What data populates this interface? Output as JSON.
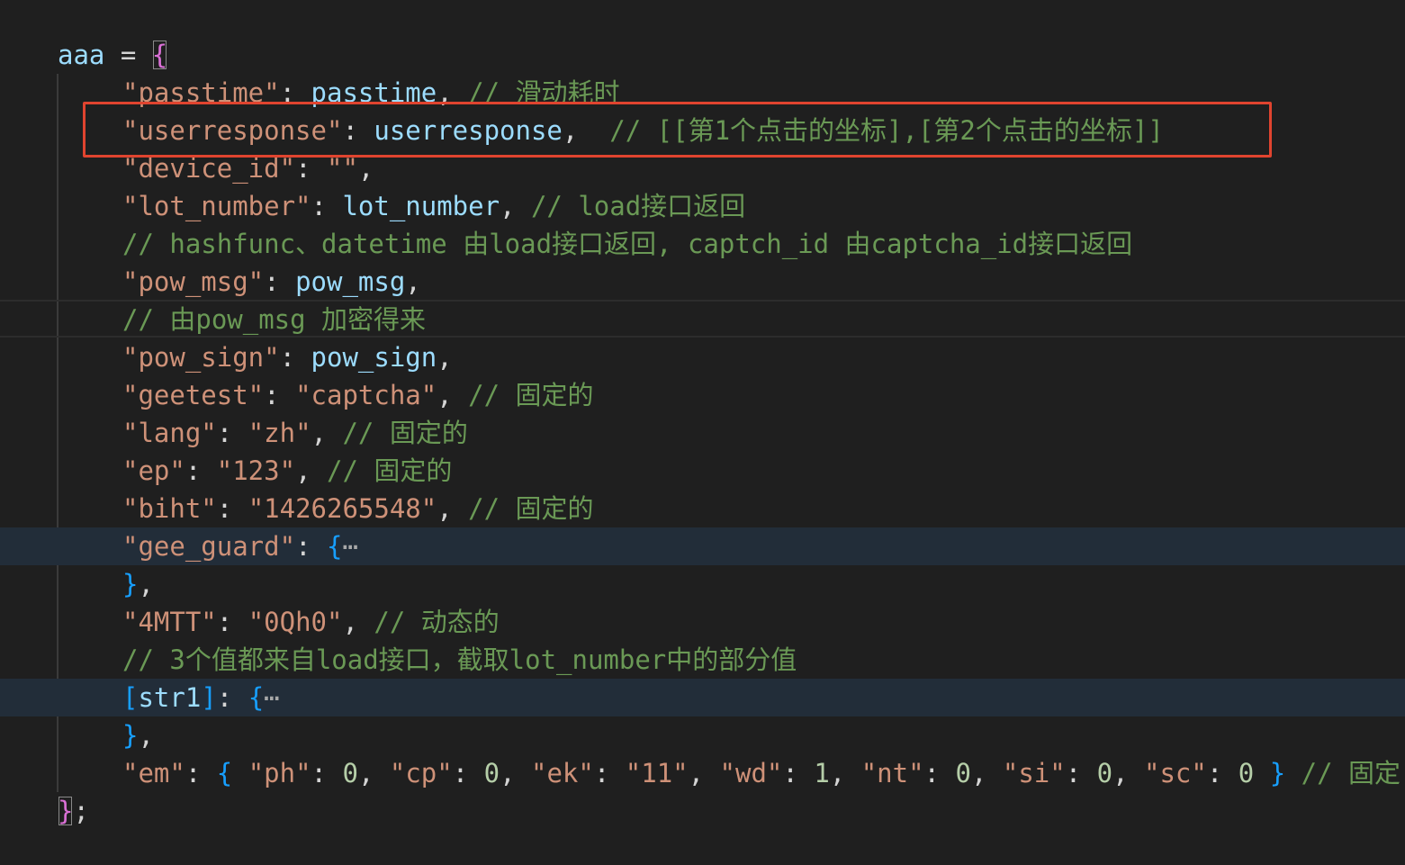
{
  "editor": {
    "lines": [
      {
        "t": [
          {
            "c": "var",
            "v": "aaa"
          },
          {
            "c": "pun",
            "v": " = "
          },
          {
            "c": "br1",
            "v": "{"
          }
        ]
      },
      {
        "t": [
          {
            "c": "str",
            "v": "\"passtime\""
          },
          {
            "c": "pun",
            "v": ": "
          },
          {
            "c": "var",
            "v": "passtime"
          },
          {
            "c": "pun",
            "v": ", "
          },
          {
            "c": "cmt",
            "v": "// 滑动耗时"
          }
        ]
      },
      {
        "t": [
          {
            "c": "str",
            "v": "\"userresponse\""
          },
          {
            "c": "pun",
            "v": ": "
          },
          {
            "c": "var",
            "v": "userresponse"
          },
          {
            "c": "pun",
            "v": ",  "
          },
          {
            "c": "cmt",
            "v": "// [[第1个点击的坐标],[第2个点击的坐标]]"
          }
        ]
      },
      {
        "t": [
          {
            "c": "str",
            "v": "\"device_id\""
          },
          {
            "c": "pun",
            "v": ": "
          },
          {
            "c": "str",
            "v": "\"\""
          },
          {
            "c": "pun",
            "v": ","
          }
        ]
      },
      {
        "t": [
          {
            "c": "str",
            "v": "\"lot_number\""
          },
          {
            "c": "pun",
            "v": ": "
          },
          {
            "c": "var",
            "v": "lot_number"
          },
          {
            "c": "pun",
            "v": ", "
          },
          {
            "c": "cmt",
            "v": "// load接口返回"
          }
        ]
      },
      {
        "t": [
          {
            "c": "cmt",
            "v": "// hashfunc、datetime 由load接口返回, captch_id 由captcha_id接口返回"
          }
        ]
      },
      {
        "t": [
          {
            "c": "str",
            "v": "\"pow_msg\""
          },
          {
            "c": "pun",
            "v": ": "
          },
          {
            "c": "var",
            "v": "pow_msg"
          },
          {
            "c": "pun",
            "v": ","
          }
        ]
      },
      {
        "t": [
          {
            "c": "cmt",
            "v": "// 由pow_msg 加密得来"
          }
        ]
      },
      {
        "t": [
          {
            "c": "str",
            "v": "\"pow_sign\""
          },
          {
            "c": "pun",
            "v": ": "
          },
          {
            "c": "var",
            "v": "pow_sign"
          },
          {
            "c": "pun",
            "v": ","
          }
        ]
      },
      {
        "t": [
          {
            "c": "str",
            "v": "\"geetest\""
          },
          {
            "c": "pun",
            "v": ": "
          },
          {
            "c": "str",
            "v": "\"captcha\""
          },
          {
            "c": "pun",
            "v": ", "
          },
          {
            "c": "cmt",
            "v": "// 固定的"
          }
        ]
      },
      {
        "t": [
          {
            "c": "str",
            "v": "\"lang\""
          },
          {
            "c": "pun",
            "v": ": "
          },
          {
            "c": "str",
            "v": "\"zh\""
          },
          {
            "c": "pun",
            "v": ", "
          },
          {
            "c": "cmt",
            "v": "// 固定的"
          }
        ]
      },
      {
        "t": [
          {
            "c": "str",
            "v": "\"ep\""
          },
          {
            "c": "pun",
            "v": ": "
          },
          {
            "c": "str",
            "v": "\"123\""
          },
          {
            "c": "pun",
            "v": ", "
          },
          {
            "c": "cmt",
            "v": "// 固定的"
          }
        ]
      },
      {
        "t": [
          {
            "c": "str",
            "v": "\"biht\""
          },
          {
            "c": "pun",
            "v": ": "
          },
          {
            "c": "str",
            "v": "\"1426265548\""
          },
          {
            "c": "pun",
            "v": ", "
          },
          {
            "c": "cmt",
            "v": "// 固定的"
          }
        ]
      },
      {
        "t": [
          {
            "c": "str",
            "v": "\"gee_guard\""
          },
          {
            "c": "pun",
            "v": ": "
          },
          {
            "c": "br2",
            "v": "{"
          },
          {
            "c": "ell",
            "v": "⋯"
          }
        ]
      },
      {
        "t": [
          {
            "c": "br2",
            "v": "}"
          },
          {
            "c": "pun",
            "v": ","
          }
        ]
      },
      {
        "t": [
          {
            "c": "str",
            "v": "\"4MTT\""
          },
          {
            "c": "pun",
            "v": ": "
          },
          {
            "c": "str",
            "v": "\"0Qh0\""
          },
          {
            "c": "pun",
            "v": ", "
          },
          {
            "c": "cmt",
            "v": "// 动态的"
          }
        ]
      },
      {
        "t": [
          {
            "c": "cmt",
            "v": "// 3个值都来自load接口，截取lot_number中的部分值"
          }
        ]
      },
      {
        "t": [
          {
            "c": "br2",
            "v": "["
          },
          {
            "c": "var",
            "v": "str1"
          },
          {
            "c": "br2",
            "v": "]"
          },
          {
            "c": "pun",
            "v": ": "
          },
          {
            "c": "br2",
            "v": "{"
          },
          {
            "c": "ell",
            "v": "⋯"
          }
        ]
      },
      {
        "t": [
          {
            "c": "br2",
            "v": "}"
          },
          {
            "c": "pun",
            "v": ","
          }
        ]
      },
      {
        "t": [
          {
            "c": "str",
            "v": "\"em\""
          },
          {
            "c": "pun",
            "v": ": "
          },
          {
            "c": "br2",
            "v": "{"
          },
          {
            "c": "pun",
            "v": " "
          },
          {
            "c": "str",
            "v": "\"ph\""
          },
          {
            "c": "pun",
            "v": ": "
          },
          {
            "c": "num",
            "v": "0"
          },
          {
            "c": "pun",
            "v": ", "
          },
          {
            "c": "str",
            "v": "\"cp\""
          },
          {
            "c": "pun",
            "v": ": "
          },
          {
            "c": "num",
            "v": "0"
          },
          {
            "c": "pun",
            "v": ", "
          },
          {
            "c": "str",
            "v": "\"ek\""
          },
          {
            "c": "pun",
            "v": ": "
          },
          {
            "c": "str",
            "v": "\"11\""
          },
          {
            "c": "pun",
            "v": ", "
          },
          {
            "c": "str",
            "v": "\"wd\""
          },
          {
            "c": "pun",
            "v": ": "
          },
          {
            "c": "num",
            "v": "1"
          },
          {
            "c": "pun",
            "v": ", "
          },
          {
            "c": "str",
            "v": "\"nt\""
          },
          {
            "c": "pun",
            "v": ": "
          },
          {
            "c": "num",
            "v": "0"
          },
          {
            "c": "pun",
            "v": ", "
          },
          {
            "c": "str",
            "v": "\"si\""
          },
          {
            "c": "pun",
            "v": ": "
          },
          {
            "c": "num",
            "v": "0"
          },
          {
            "c": "pun",
            "v": ", "
          },
          {
            "c": "str",
            "v": "\"sc\""
          },
          {
            "c": "pun",
            "v": ": "
          },
          {
            "c": "num",
            "v": "0"
          },
          {
            "c": "pun",
            "v": " "
          },
          {
            "c": "br2",
            "v": "}"
          },
          {
            "c": "pun",
            "v": " "
          },
          {
            "c": "cmt",
            "v": "// 固定"
          }
        ]
      },
      {
        "t": [
          {
            "c": "br1",
            "v": "}"
          },
          {
            "c": "pun",
            "v": ";"
          }
        ]
      }
    ]
  },
  "annotation": {
    "highlight_color": "#e0442f",
    "highlighted_line": 3
  }
}
